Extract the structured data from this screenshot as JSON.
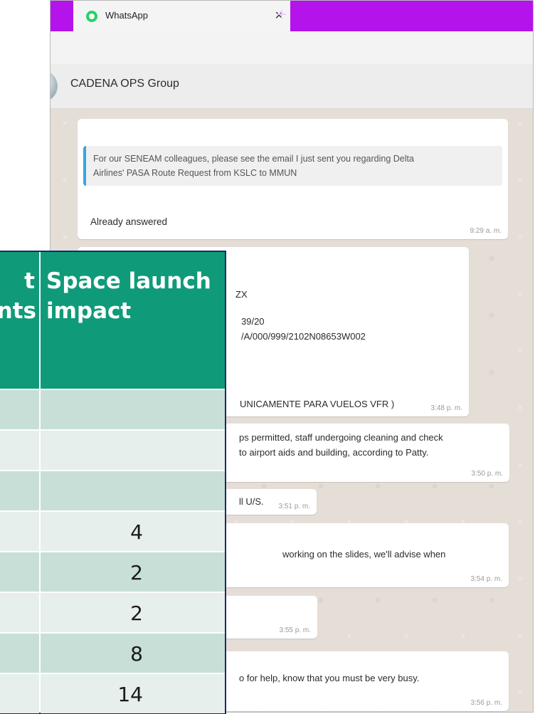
{
  "browser": {
    "tab_title": "WhatsApp",
    "tab_close": "×",
    "new_tab": "+"
  },
  "chat": {
    "name": "CADENA OPS Group"
  },
  "messages": [
    {
      "quote_line1": "For our SENEAM colleagues, please see the email I just sent you regarding Delta",
      "quote_line2": "Airlines' PASA Route Request from KSLC to MMUN",
      "text": "Already answered",
      "time": "9:29 a. m."
    },
    {
      "line1": "ZX",
      "line2": "39/20",
      "line3": "/A/000/999/2102N08653W002",
      "line4": " UNICAMENTE PARA VUELOS VFR )",
      "time": "3:48 p. m."
    },
    {
      "line1": "ps permitted, staff undergoing cleaning and check",
      "line2": " to airport aids and building, according to Patty.",
      "time": "3:50 p. m."
    },
    {
      "line1": "ll U/S.",
      "time": "3:51 p. m."
    },
    {
      "line1": "working on the slides, we'll advise when",
      "time": "3:54 p. m."
    },
    {
      "time": "3:55 p. m."
    },
    {
      "line1": "o for help, know that you must be very busy.",
      "time": "3:56 p. m."
    }
  ],
  "table": {
    "left_header_line1": "t",
    "left_header_line2": "nts",
    "right_header_line1": "Space launch",
    "right_header_line2": "impact",
    "rows": [
      {
        "value": ""
      },
      {
        "value": ""
      },
      {
        "value": ""
      },
      {
        "value": "4"
      },
      {
        "value": "2"
      },
      {
        "value": "2"
      },
      {
        "value": "8"
      },
      {
        "value": "14"
      }
    ],
    "colors": {
      "header": "#0f9b79",
      "row_dark": "#c7dfd7",
      "row_light": "#e6efeb",
      "border": "#1a2a6a"
    }
  }
}
